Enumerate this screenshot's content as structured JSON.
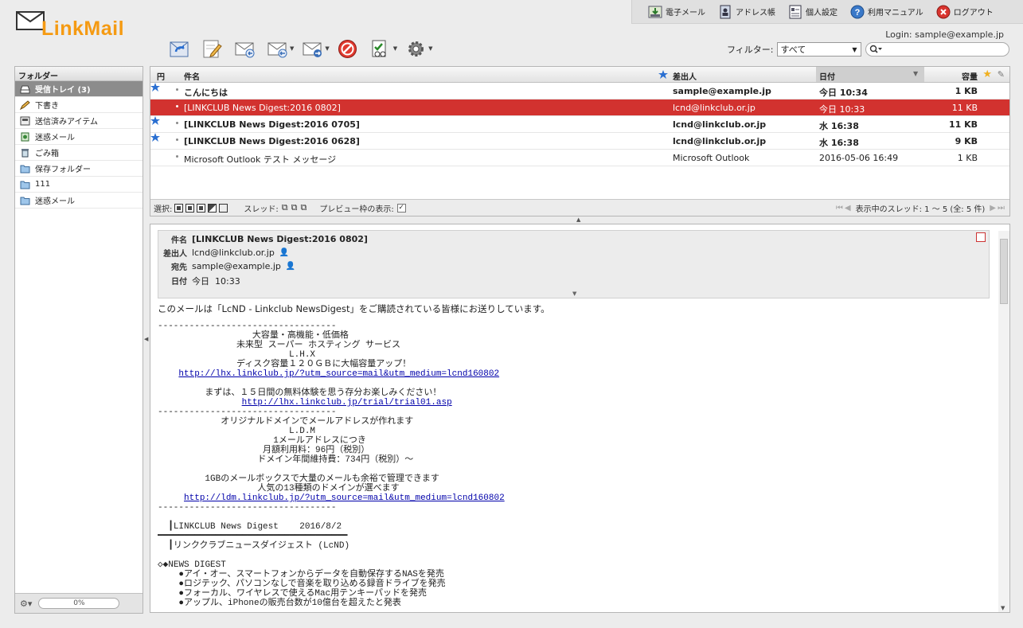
{
  "app": {
    "logo_text": "LinkMail"
  },
  "topmenu": [
    {
      "label": "電子メール",
      "icon": "mail-download-icon"
    },
    {
      "label": "アドレス帳",
      "icon": "address-book-icon"
    },
    {
      "label": "個人設定",
      "icon": "settings-doc-icon"
    },
    {
      "label": "利用マニュアル",
      "icon": "help-icon"
    },
    {
      "label": "ログアウト",
      "icon": "logout-icon"
    }
  ],
  "login_text": "Login: sample@example.jp",
  "filter": {
    "label": "フィルター:",
    "value": "すべて"
  },
  "folders": {
    "header": "フォルダー",
    "items": [
      {
        "label": "受信トレイ (3)",
        "icon": "inbox-icon",
        "active": true
      },
      {
        "label": "下書き",
        "icon": "pencil-icon"
      },
      {
        "label": "送信済みアイテム",
        "icon": "sent-icon"
      },
      {
        "label": "迷惑メール",
        "icon": "junk-icon"
      },
      {
        "label": "ごみ箱",
        "icon": "trash-icon"
      },
      {
        "label": "保存フォルダー",
        "icon": "folder-icon"
      },
      {
        "label": "111",
        "icon": "folder-icon"
      },
      {
        "label": "迷惑メール",
        "icon": "folder-icon"
      }
    ],
    "quota": "0%"
  },
  "list": {
    "headers": {
      "thread": "円",
      "subject": "件名",
      "from": "差出人",
      "date": "日付",
      "size": "容量"
    },
    "rows": [
      {
        "subject": "こんにちは",
        "from": "sample@example.jp",
        "date": "今日 10:34",
        "size": "1 KB",
        "unread": true,
        "star": true
      },
      {
        "subject": "[LINKCLUB News Digest:2016 0802]",
        "from": "lcnd@linkclub.or.jp",
        "date": "今日 10:33",
        "size": "11 KB",
        "selected": true
      },
      {
        "subject": "[LINKCLUB News Digest:2016 0705]",
        "from": "lcnd@linkclub.or.jp",
        "date": "水 16:38",
        "size": "11 KB",
        "unread": true,
        "star": true
      },
      {
        "subject": "[LINKCLUB News Digest:2016 0628]",
        "from": "lcnd@linkclub.or.jp",
        "date": "水 16:38",
        "size": "9 KB",
        "unread": true,
        "star": true
      },
      {
        "subject": "Microsoft Outlook テスト メッセージ",
        "from": "Microsoft Outlook",
        "date": "2016-05-06 16:49",
        "size": "1 KB"
      }
    ],
    "footer": {
      "select_label": "選択:",
      "thread_label": "スレッド:",
      "preview_label": "プレビュー枠の表示:",
      "status": "表示中のスレッド: 1 ～ 5 (全: 5 件)"
    }
  },
  "preview": {
    "labels": {
      "subject": "件名",
      "from": "差出人",
      "to": "宛先",
      "date": "日付"
    },
    "subject": "[LINKCLUB News Digest:2016 0802]",
    "from": "lcnd@linkclub.or.jp",
    "to": "sample@example.jp",
    "date": "今日  10:33",
    "intro": "このメールは「LcND - Linkclub NewsDigest」をご購読されている皆様にお送りしています。",
    "lines": [
      "----------------------------------",
      "                  大容量・高機能・低価格",
      "               未来型 スーパー ホスティング サービス",
      "                         L.H.X",
      "               ディスク容量１２０ＧＢに大幅容量アップ！",
      "    http://lhx.linkclub.jp/?utm_source=mail&utm_medium=lcnd160802",
      "",
      "         まずは、１５日間の無料体験を思う存分お楽しみください！",
      "                http://lhx.linkclub.jp/trial/trial01.asp",
      "----------------------------------",
      "            オリジナルドメインでメールアドレスが作れます",
      "                         L.D.M",
      "                      1メールアドレスにつき",
      "                    月額利用料：96円（税別）",
      "                   ドメイン年間維持費：734円（税別）～",
      "",
      "         1GBのメールボックスで大量のメールも余裕で管理できます",
      "                   人気の13種類のドメインが選べます",
      "     http://ldm.linkclub.jp/?utm_source=mail&utm_medium=lcnd160802",
      "----------------------------------",
      "",
      "  ┃LINKCLUB News Digest    2016/8/2",
      "━━━━━━━━━━━━━━━━━━━━━━━━━━━━━━━━━━━━",
      "  ┃リンククラブニュースダイジェスト (LcND)",
      "",
      "◇◆NEWS DIGEST",
      "    ●アイ・オー、スマートフォンからデータを自動保存するNASを発売",
      "    ●ロジテック、パソコンなしで音楽を取り込める録音ドライブを発売",
      "    ●フォーカル、ワイヤレスで使えるMac用テンキーパッドを発売",
      "    ●アップル、iPhoneの販売台数が10億台を超えたと発表"
    ]
  },
  "colors": {
    "selected_row": "#d2322f",
    "logo_orange": "#f59a12",
    "link": "#0000aa"
  }
}
